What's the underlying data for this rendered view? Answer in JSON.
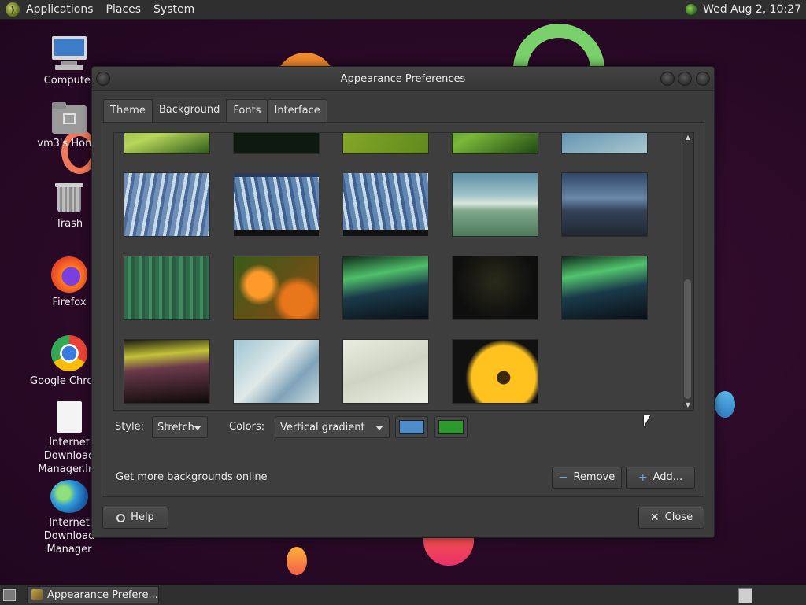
{
  "top_panel": {
    "menus": [
      "Applications",
      "Places",
      "System"
    ],
    "clock": "Wed Aug  2, 10:27"
  },
  "desktop": {
    "icons": [
      {
        "label": "Computer",
        "icon": "computer-icon"
      },
      {
        "label": "vm3's Home",
        "icon": "home-folder-icon"
      },
      {
        "label": "Trash",
        "icon": "trash-icon"
      },
      {
        "label": "Firefox",
        "icon": "firefox-icon"
      },
      {
        "label": "Google Chrome",
        "icon": "chrome-icon"
      },
      {
        "label": "Internet Download Manager.lnk",
        "icon": "file-icon"
      },
      {
        "label": "Internet Download Manager",
        "icon": "idm-icon"
      }
    ]
  },
  "window": {
    "title": "Appearance Preferences",
    "tabs": [
      "Theme",
      "Background",
      "Fonts",
      "Interface"
    ],
    "active_tab": "Background",
    "style_label": "Style:",
    "style_value": "Stretch",
    "colors_label": "Colors:",
    "colors_value": "Vertical gradient",
    "color_primary": "#4f8cc9",
    "color_secondary": "#2e9a2e",
    "more_link": "Get more backgrounds online",
    "remove_label": "Remove",
    "add_label": "Add...",
    "help_label": "Help",
    "close_label": "Close"
  },
  "taskbar": {
    "task_label": "Appearance Prefere..."
  }
}
